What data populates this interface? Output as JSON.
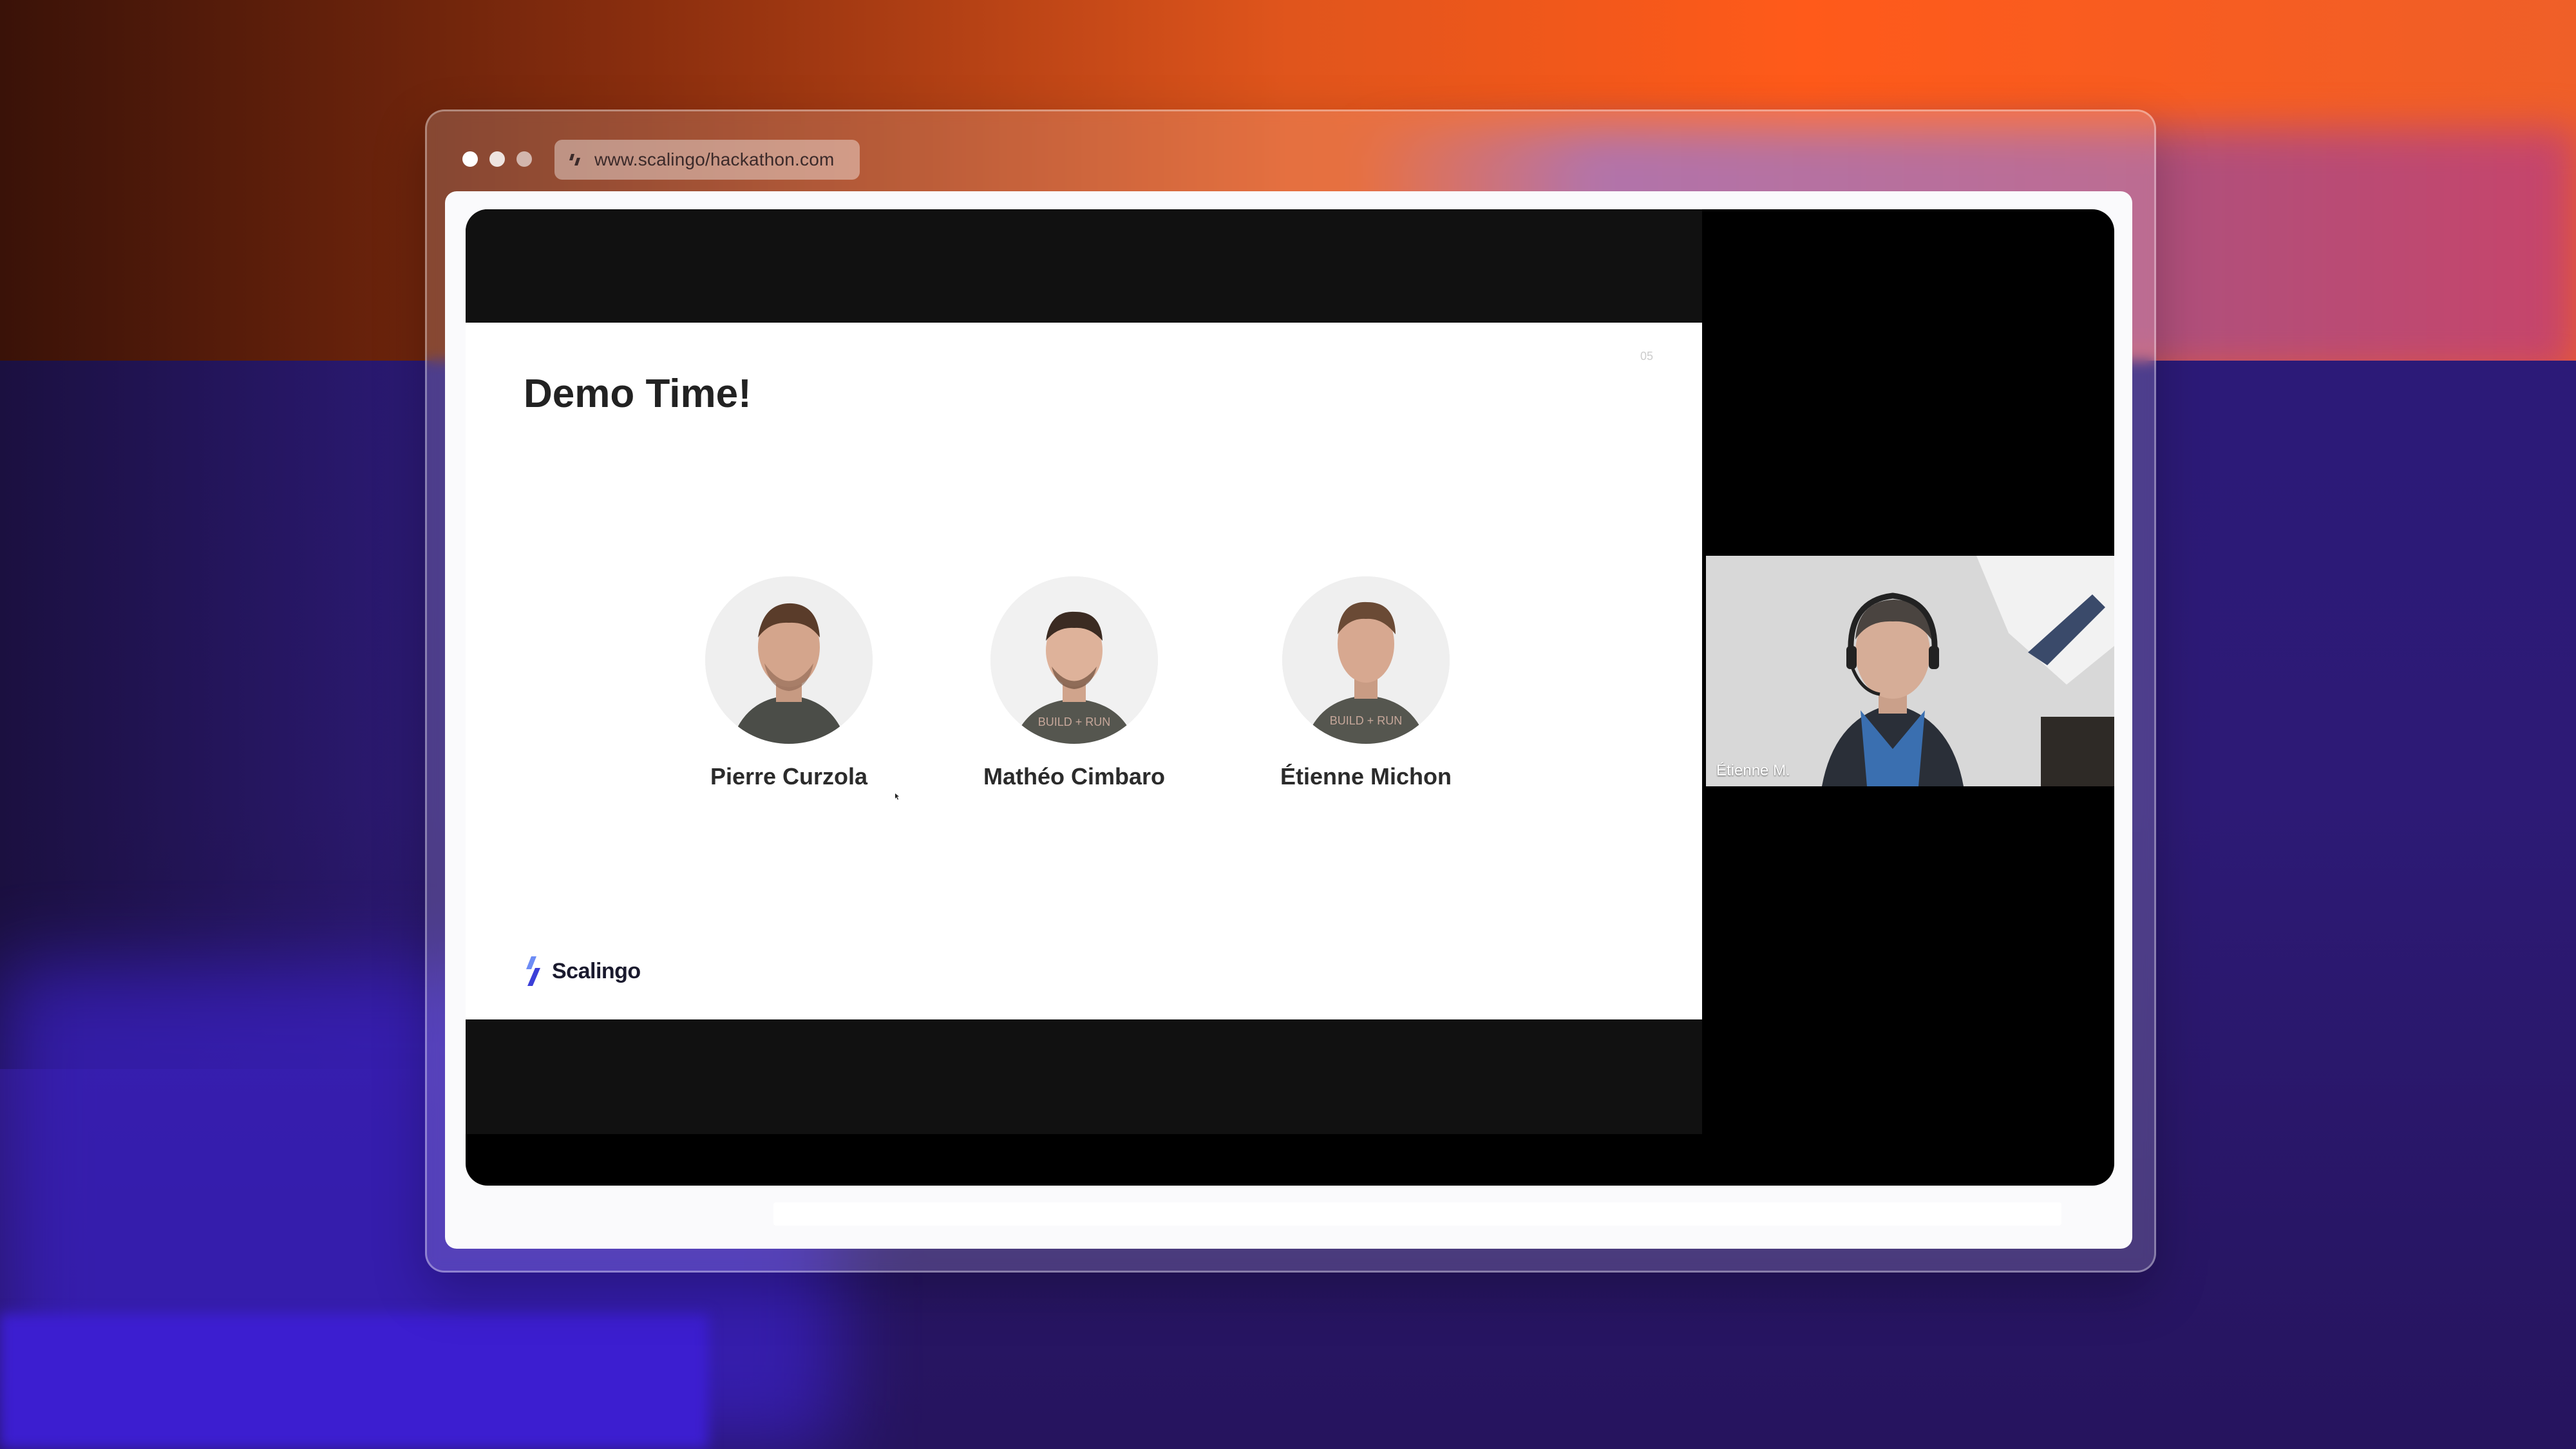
{
  "browser": {
    "url": "www.scalingo/hackathon.com"
  },
  "slide": {
    "title": "Demo Time!",
    "page_number": "05",
    "people": [
      {
        "name": "Pierre Curzola"
      },
      {
        "name": "Mathéo Cimbaro"
      },
      {
        "name": "Étienne Michon"
      }
    ],
    "brand": "Scalingo"
  },
  "video": {
    "participant_label": "Étienne M."
  },
  "colors": {
    "brand_blue": "#3b3fd8",
    "brand_light": "#6d8cf5"
  }
}
